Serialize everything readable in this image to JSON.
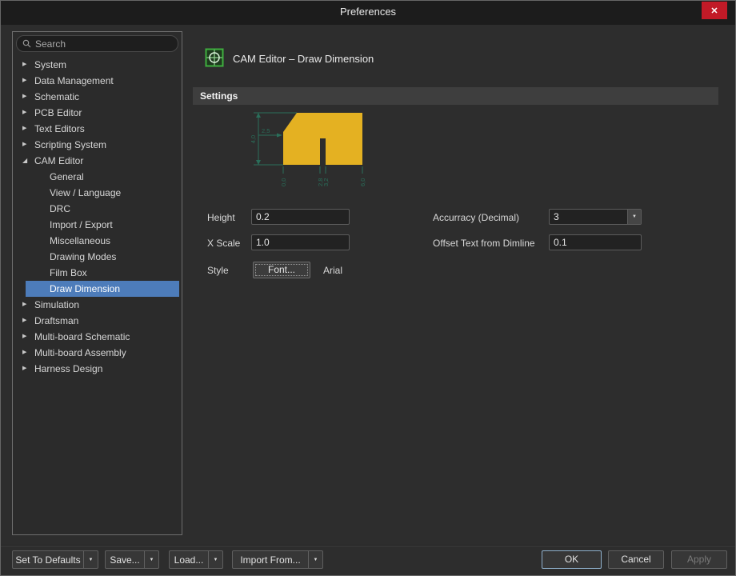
{
  "window": {
    "title": "Preferences",
    "close_glyph": "✕"
  },
  "icons": {
    "collapsed": "▶",
    "expanded": "◢",
    "dropdown": "▼"
  },
  "colors": {
    "selection": "#4d7cba",
    "close_button": "#c21a27",
    "section_bar": "#3e3e3e"
  },
  "search": {
    "placeholder": "Search"
  },
  "sidebar": {
    "items": [
      {
        "label": "System"
      },
      {
        "label": "Data Management"
      },
      {
        "label": "Schematic"
      },
      {
        "label": "PCB Editor"
      },
      {
        "label": "Text Editors"
      },
      {
        "label": "Scripting System"
      },
      {
        "label": "CAM Editor"
      },
      {
        "label": "General"
      },
      {
        "label": "View / Language"
      },
      {
        "label": "DRC"
      },
      {
        "label": "Import / Export"
      },
      {
        "label": "Miscellaneous"
      },
      {
        "label": "Drawing Modes"
      },
      {
        "label": "Film Box"
      },
      {
        "label": "Draw Dimension"
      },
      {
        "label": "Simulation"
      },
      {
        "label": "Draftsman"
      },
      {
        "label": "Multi-board Schematic"
      },
      {
        "label": "Multi-board Assembly"
      },
      {
        "label": "Harness Design"
      }
    ]
  },
  "header": {
    "title": "CAM Editor – Draw Dimension"
  },
  "settings": {
    "section_label": "Settings",
    "height_label": "Height",
    "height_value": "0.2",
    "xscale_label": "X Scale",
    "xscale_value": "1.0",
    "style_label": "Style",
    "font_button_label": "Font...",
    "font_name": "Arial",
    "accuracy_label": "Accurracy (Decimal)",
    "accuracy_value": "3",
    "offset_label": "Offset Text from Dimline",
    "offset_value": "0.1",
    "preview": {
      "dim_vertical_label": "4,0",
      "dim_chamfer_label": "2,5",
      "x_labels": [
        "0,0",
        "2,8",
        "3,2",
        "6,0"
      ],
      "shape_color": "#e4b122",
      "dim_color": "#2a6e5a"
    }
  },
  "footer": {
    "set_to_defaults_label": "Set To Defaults",
    "save_label": "Save...",
    "load_label": "Load...",
    "import_from_label": "Import From...",
    "ok_label": "OK",
    "cancel_label": "Cancel",
    "apply_label": "Apply"
  }
}
